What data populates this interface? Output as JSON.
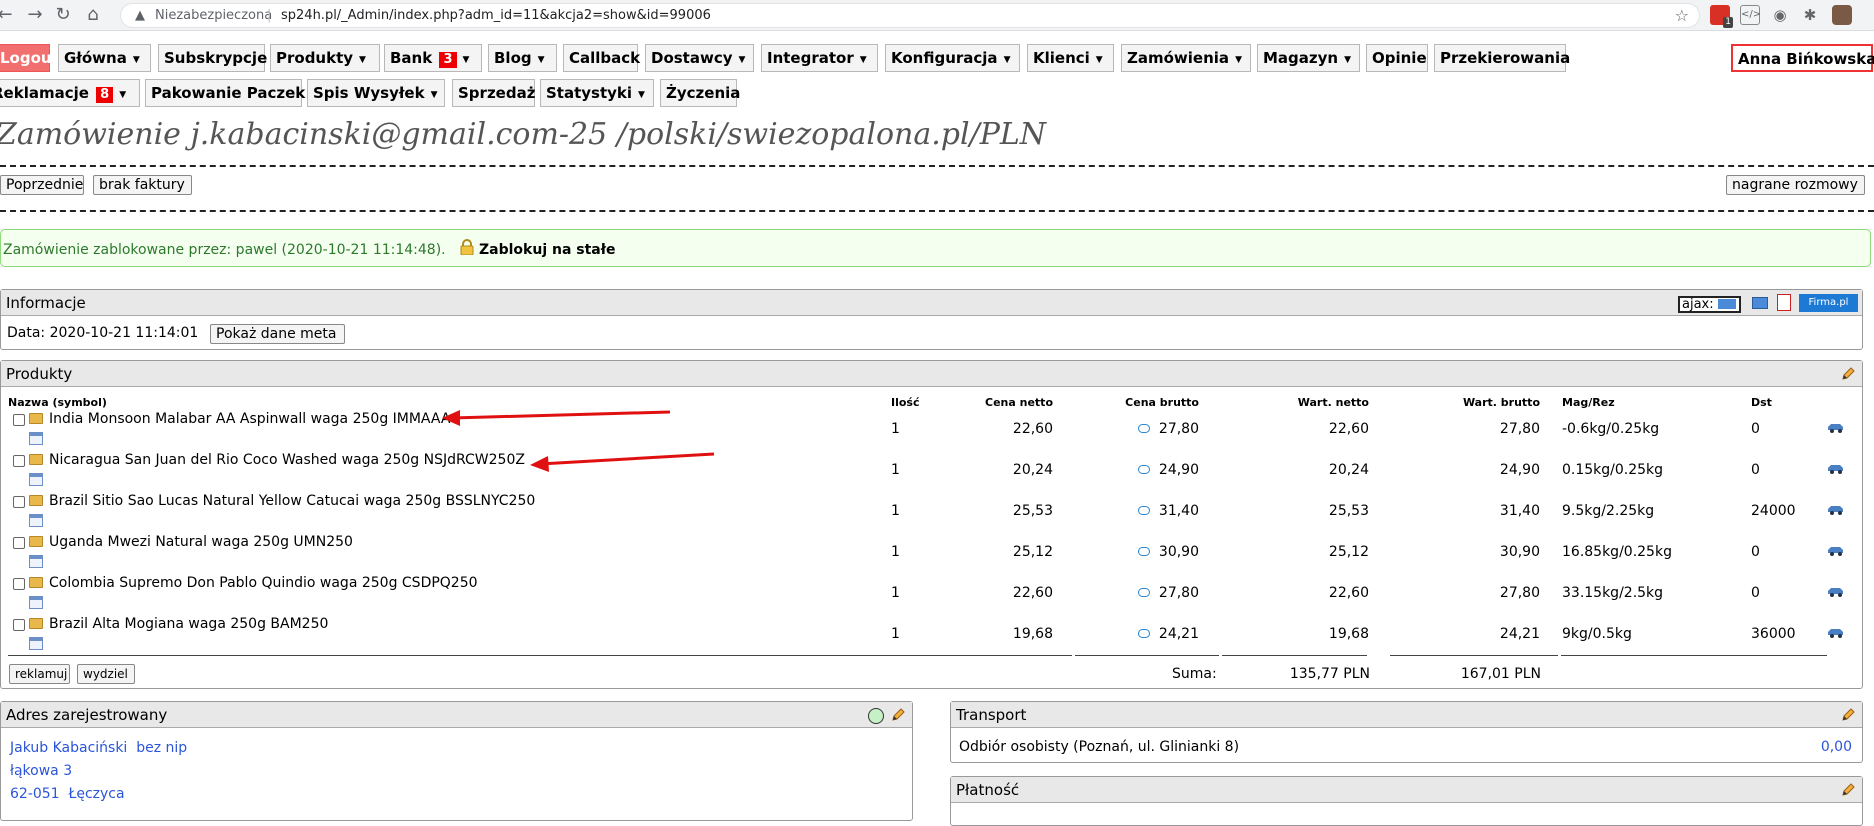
{
  "browser": {
    "security": "Niezabezpieczona",
    "url": "sp24h.pl/_Admin/index.php?adm_id=11&akcja2=show&id=99006",
    "ext_badge": "1"
  },
  "menu": {
    "logout": "Logout",
    "glowna": "Główna",
    "subskrypcje": "Subskrypcje",
    "produkty": "Produkty",
    "bank": "Bank",
    "bank_badge": "3",
    "blog": "Blog",
    "callback": "Callback",
    "dostawcy": "Dostawcy",
    "integrator": "Integrator",
    "konfiguracja": "Konfiguracja",
    "klienci": "Klienci",
    "zamowienia": "Zamówienia",
    "magazyn": "Magazyn",
    "opinie": "Opinie",
    "przekierowania": "Przekierowania",
    "user": "Anna Bińkowska",
    "reklamacje": "Reklamacje",
    "reklamacje_badge": "8",
    "pakowanie": "Pakowanie Paczek",
    "spis": "Spis Wysyłek",
    "sprzedaz": "Sprzedaż",
    "statystyki": "Statystyki",
    "zyczenia": "Życzenia"
  },
  "page": {
    "title": "Zamówienie j.kabacinski@gmail.com-25 /polski/swiezopalona.pl/PLN",
    "btn_prev": "Poprzednie",
    "btn_no_invoice": "brak faktury",
    "btn_recordings": "nagrane rozmowy",
    "lock_msg": "Zamówienie zablokowane przez: pawel (2020-10-21 11:14:48).",
    "lock_perm": "Zablokuj na stałe"
  },
  "info": {
    "title": "Informacje",
    "ajax_label": "ajax:",
    "firma": "Firma.pl",
    "date_label": "Data:",
    "date": "2020-10-21 11:14:01",
    "meta_btn": "Pokaż dane meta"
  },
  "products": {
    "title": "Produkty",
    "columns": {
      "name": "Nazwa (symbol)",
      "qty": "Ilość",
      "net": "Cena netto",
      "gross": "Cena brutto",
      "val_net": "Wart. netto",
      "val_gross": "Wart. brutto",
      "stock": "Mag/Rez",
      "dst": "Dst"
    },
    "rows": [
      {
        "name": "India Monsoon Malabar AA Aspinwall waga 250g IMMAAA",
        "qty": "1",
        "net": "22,60",
        "gross": "27,80",
        "val_net": "22,60",
        "val_gross": "27,80",
        "stock": "-0.6kg/0.25kg",
        "dst": "0"
      },
      {
        "name": "Nicaragua San Juan del Rio Coco Washed waga 250g NSJdRCW250Z",
        "qty": "1",
        "net": "20,24",
        "gross": "24,90",
        "val_net": "20,24",
        "val_gross": "24,90",
        "stock": "0.15kg/0.25kg",
        "dst": "0"
      },
      {
        "name": "Brazil Sitio Sao Lucas Natural Yellow Catucai waga 250g BSSLNYC250",
        "qty": "1",
        "net": "25,53",
        "gross": "31,40",
        "val_net": "25,53",
        "val_gross": "31,40",
        "stock": "9.5kg/2.25kg",
        "dst": "24000"
      },
      {
        "name": "Uganda Mwezi Natural waga 250g UMN250",
        "qty": "1",
        "net": "25,12",
        "gross": "30,90",
        "val_net": "25,12",
        "val_gross": "30,90",
        "stock": "16.85kg/0.25kg",
        "dst": "0"
      },
      {
        "name": "Colombia Supremo Don Pablo Quindio waga 250g CSDPQ250",
        "qty": "1",
        "net": "22,60",
        "gross": "27,80",
        "val_net": "22,60",
        "val_gross": "27,80",
        "stock": "33.15kg/2.5kg",
        "dst": "0"
      },
      {
        "name": "Brazil Alta Mogiana waga 250g BAM250",
        "qty": "1",
        "net": "19,68",
        "gross": "24,21",
        "val_net": "19,68",
        "val_gross": "24,21",
        "stock": "9kg/0.5kg",
        "dst": "36000"
      }
    ],
    "btn_reklamuj": "reklamuj",
    "btn_wydziel": "wydziel",
    "sum_label": "Suma:",
    "sum_net": "135,77 PLN",
    "sum_gross": "167,01 PLN"
  },
  "address": {
    "title": "Adres zarejestrowany",
    "name": "Jakub Kabaciński  bez nip",
    "street": "łąkowa 3",
    "city": "62-051  Łęczyca"
  },
  "transport": {
    "title": "Transport",
    "method": "Odbiór osobisty (Poznań, ul. Glinianki 8)",
    "price": "0,00"
  },
  "payment": {
    "title": "Płatność"
  },
  "colors": {
    "accent_red": "#e33",
    "link_blue": "#2b55d8",
    "lock_green": "#2d7a2d"
  }
}
